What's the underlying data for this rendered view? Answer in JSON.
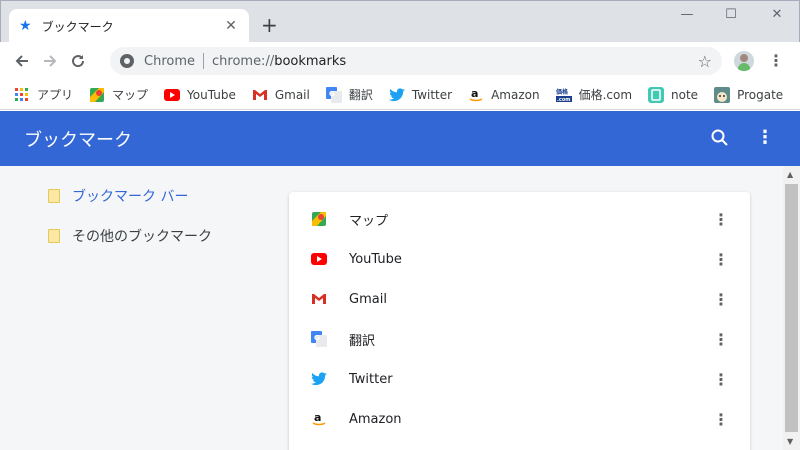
{
  "tab": {
    "title": "ブックマーク",
    "icon": "star-icon",
    "close_label": "✕"
  },
  "window": {
    "minimize": "—",
    "maximize": "☐",
    "close": "✕"
  },
  "toolbar": {
    "origin": "Chrome",
    "url_prefix": "chrome://",
    "url_path": "bookmarks"
  },
  "bookmarks_bar": [
    {
      "label": "アプリ",
      "icon": "apps-grid-icon"
    },
    {
      "label": "マップ",
      "icon": "maps-icon"
    },
    {
      "label": "YouTube",
      "icon": "youtube-icon"
    },
    {
      "label": "Gmail",
      "icon": "gmail-icon"
    },
    {
      "label": "翻訳",
      "icon": "translate-icon"
    },
    {
      "label": "Twitter",
      "icon": "twitter-icon"
    },
    {
      "label": "Amazon",
      "icon": "amazon-icon"
    },
    {
      "label": "価格.com",
      "icon": "kakaku-icon"
    },
    {
      "label": "note",
      "icon": "note-icon"
    },
    {
      "label": "Progate",
      "icon": "progate-icon"
    }
  ],
  "app": {
    "title": "ブックマーク",
    "accent": "#3367d6"
  },
  "folders": [
    {
      "label": "ブックマーク バー",
      "selected": true
    },
    {
      "label": "その他のブックマーク",
      "selected": false
    }
  ],
  "items": [
    {
      "title": "マップ",
      "icon": "maps-icon"
    },
    {
      "title": "YouTube",
      "icon": "youtube-icon"
    },
    {
      "title": "Gmail",
      "icon": "gmail-icon"
    },
    {
      "title": "翻訳",
      "icon": "translate-icon"
    },
    {
      "title": "Twitter",
      "icon": "twitter-icon"
    },
    {
      "title": "Amazon",
      "icon": "amazon-icon"
    }
  ]
}
